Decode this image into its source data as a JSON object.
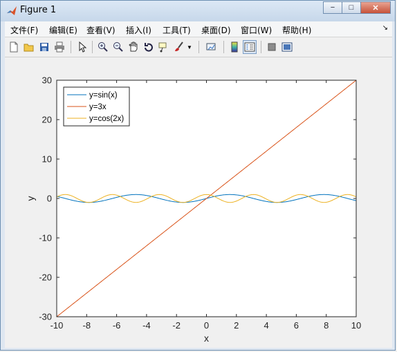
{
  "window": {
    "title": "Figure 1",
    "buttons": [
      "−",
      "□",
      "✕"
    ]
  },
  "menu": {
    "items": [
      "文件(F)",
      "编辑(E)",
      "查看(V)",
      "插入(I)",
      "工具(T)",
      "桌面(D)",
      "窗口(W)",
      "帮助(H)"
    ]
  },
  "toolbar": {
    "icons": [
      "new-figure-icon",
      "open-file-icon",
      "save-icon",
      "print-icon",
      "edit-plot-arrow-icon",
      "zoom-in-icon",
      "zoom-out-icon",
      "pan-hand-icon",
      "rotate-3d-icon",
      "data-cursor-icon",
      "brush-icon",
      "brush-dropdown-icon",
      "link-plot-icon",
      "colorbar-icon",
      "legend-icon",
      "hide-plot-tools-icon",
      "show-plot-tools-icon"
    ]
  },
  "chart_data": {
    "type": "line",
    "xlabel": "x",
    "ylabel": "y",
    "xlim": [
      -10,
      10
    ],
    "ylim": [
      -30,
      30
    ],
    "xticks": [
      -10,
      -8,
      -6,
      -4,
      -2,
      0,
      2,
      4,
      6,
      8,
      10
    ],
    "yticks": [
      30,
      20,
      10,
      0,
      -10,
      -20,
      -30
    ],
    "legend_position": "top-left",
    "grid": false,
    "series": [
      {
        "name": "y=sin(x)",
        "expression": "sin(x)",
        "color": "#0072bd"
      },
      {
        "name": "y=3x",
        "expression": "3x",
        "color": "#d95319"
      },
      {
        "name": "y=cos(2x)",
        "expression": "cos(2x)",
        "color": "#edb120"
      }
    ]
  }
}
